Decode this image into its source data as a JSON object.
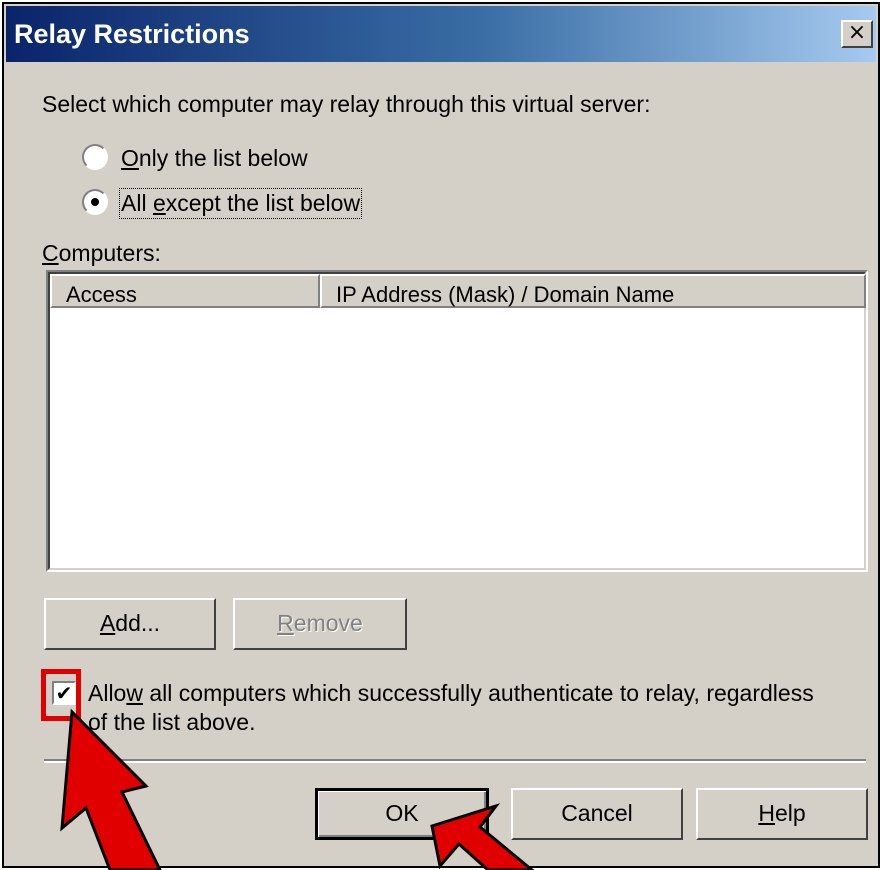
{
  "dialog": {
    "title": "Relay Restrictions",
    "close_glyph": "×",
    "instruction": "Select which computer may relay through this virtual server:",
    "radio_options": [
      {
        "key": "O",
        "rest": "nly the list below",
        "selected": false
      },
      {
        "key": "All ",
        "rest_u": "e",
        "rest": "xcept the list below",
        "selected": true
      }
    ],
    "computers_label_key": "C",
    "computers_label_rest": "omputers:",
    "list_columns": [
      "Access",
      "IP Address (Mask) / Domain Name"
    ],
    "list_rows": [],
    "buttons": {
      "add_key": "A",
      "add_rest": "dd...",
      "remove_key": "R",
      "remove_rest": "emove",
      "ok": "OK",
      "cancel": "Cancel",
      "help_key": "H",
      "help_rest": "elp"
    },
    "checkbox": {
      "checked": true,
      "glyph": "✔",
      "line1_pre": "Allo",
      "line1_key": "w",
      "line1_post": " all computers which successfully authenticate to relay, regardless",
      "line2": "of the list above."
    }
  },
  "annotations": {
    "arrow_color": "#e00000",
    "highlight_color": "#e00000"
  },
  "colors": {
    "dialog_bg": "#d4d0c8",
    "title_start": "#0a246a",
    "title_end": "#a6caf0"
  }
}
